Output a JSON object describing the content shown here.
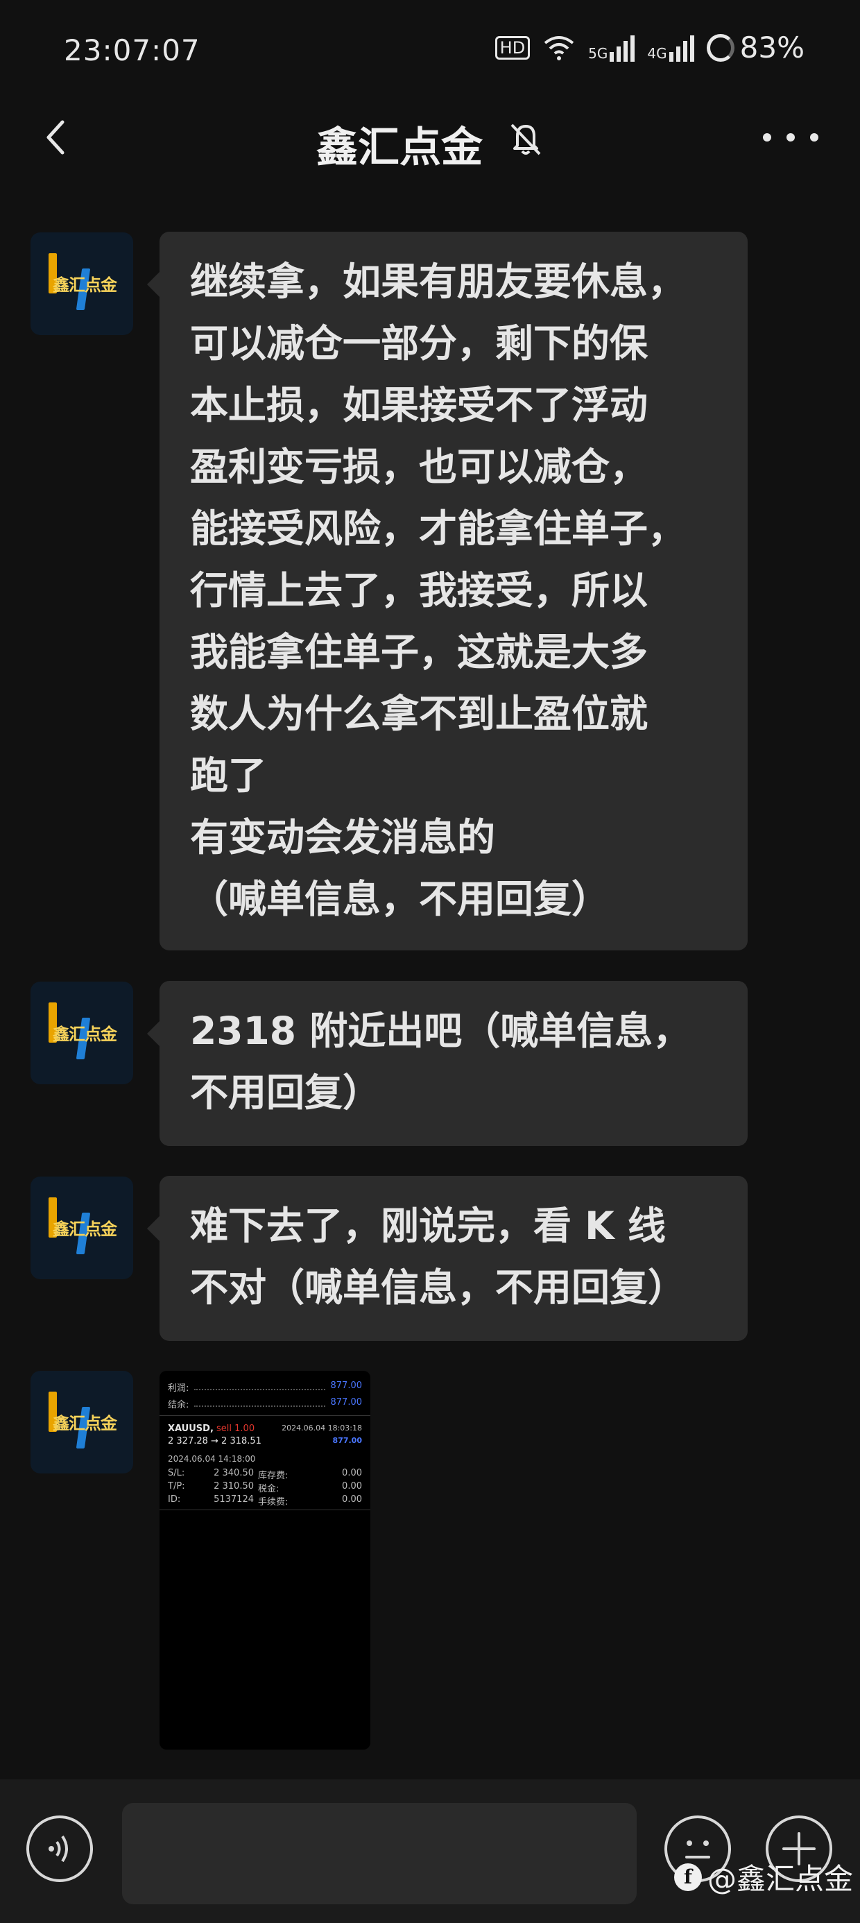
{
  "status_bar": {
    "time": "23:07:07",
    "hd_label": "HD",
    "net1": "5G",
    "net2": "4G",
    "battery": "83%"
  },
  "header": {
    "title": "鑫汇点金",
    "icons": [
      "back-arrow-icon",
      "bell-muted-icon",
      "more-icon"
    ]
  },
  "avatar": {
    "logo_text": "鑫汇点金"
  },
  "messages": [
    {
      "lines": [
        "继续拿，如果有朋友要休息，",
        "可以减仓一部分，剩下的保",
        "本止损，如果接受不了浮动",
        "盈利变亏损，也可以减仓，",
        "能接受风险，才能拿住单子，",
        "行情上去了，我接受，所以",
        "我能拿住单子，这就是大多",
        "数人为什么拿不到止盈位就",
        "跑了",
        "有变动会发消息的",
        "（喊单信息，不用回复）"
      ]
    },
    {
      "lines": [
        "2318 附近出吧（喊单信息，",
        "不用回复）"
      ]
    },
    {
      "lines": [
        "难下去了，刚说完，看 K 线",
        "不对（喊单信息，不用回复）"
      ]
    }
  ],
  "image_message": {
    "profit_label": "利润:",
    "profit_value": "877.00",
    "balance_label": "结余:",
    "balance_value": "877.00",
    "symbol": "XAUUSD,",
    "side": "sell 1.00",
    "close_time": "2024.06.04 18:03:18",
    "prices": "2 327.28 → 2 318.51",
    "pnl": "877.00",
    "open_time": "2024.06.04 14:18:00",
    "rows": [
      [
        "S/L:",
        "2 340.50",
        "库存费:",
        "0.00"
      ],
      [
        "T/P:",
        "2 310.50",
        "税金:",
        "0.00"
      ],
      [
        "ID:",
        "5137124",
        "手续费:",
        "0.00"
      ]
    ]
  },
  "bottom_bar": {
    "icons": [
      "voice-icon",
      "emoji-icon",
      "plus-icon"
    ],
    "watermark": "@鑫汇点金"
  }
}
